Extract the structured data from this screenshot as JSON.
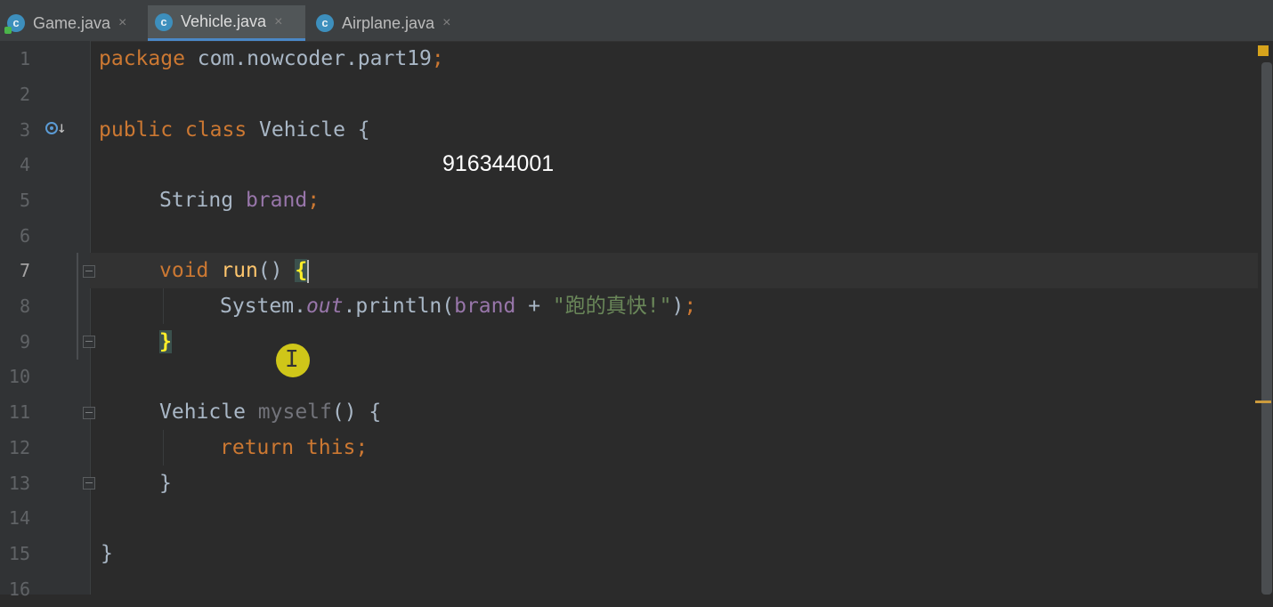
{
  "tabs": [
    {
      "label": "Game.java",
      "icon": "java-class-icon",
      "active": false
    },
    {
      "label": "Vehicle.java",
      "icon": "java-class-icon",
      "active": true
    },
    {
      "label": "Airplane.java",
      "icon": "java-class-icon",
      "active": false
    }
  ],
  "tab_close_glyph": "×",
  "tab_icon_letter": "c",
  "line_numbers": [
    "1",
    "2",
    "3",
    "4",
    "5",
    "6",
    "7",
    "8",
    "9",
    "10",
    "11",
    "12",
    "13",
    "14",
    "15",
    "16"
  ],
  "code": {
    "l1_kw": "package",
    "l1_rest": " com.nowcoder.part19",
    "l1_semi": ";",
    "l3_kw": "public class",
    "l3_rest": " Vehicle {",
    "l5_type": "String ",
    "l5_field": "brand",
    "l5_semi": ";",
    "l7_kw": "void ",
    "l7_fn": "run",
    "l7_paren": "() ",
    "l7_brace": "{",
    "l8_a": "System.",
    "l8_out": "out",
    "l8_b": ".println(",
    "l8_field": "brand",
    "l8_plus": " + ",
    "l8_str": "\"跑的真快!\"",
    "l8_end": ")",
    "l8_semi": ";",
    "l9_brace": "}",
    "l11_type": "Vehicle ",
    "l11_fn": "myself",
    "l11_rest": "() {",
    "l12_kw": "return this",
    "l12_semi": ";",
    "l13_brace": "}",
    "l15_brace": "}"
  },
  "overlay_number": "916344001",
  "current_line": 7,
  "colors": {
    "keyword": "#cc7832",
    "field": "#9876aa",
    "string": "#6a8759",
    "method": "#ffc66d",
    "default": "#a9b7c6",
    "background": "#2b2b2b"
  }
}
